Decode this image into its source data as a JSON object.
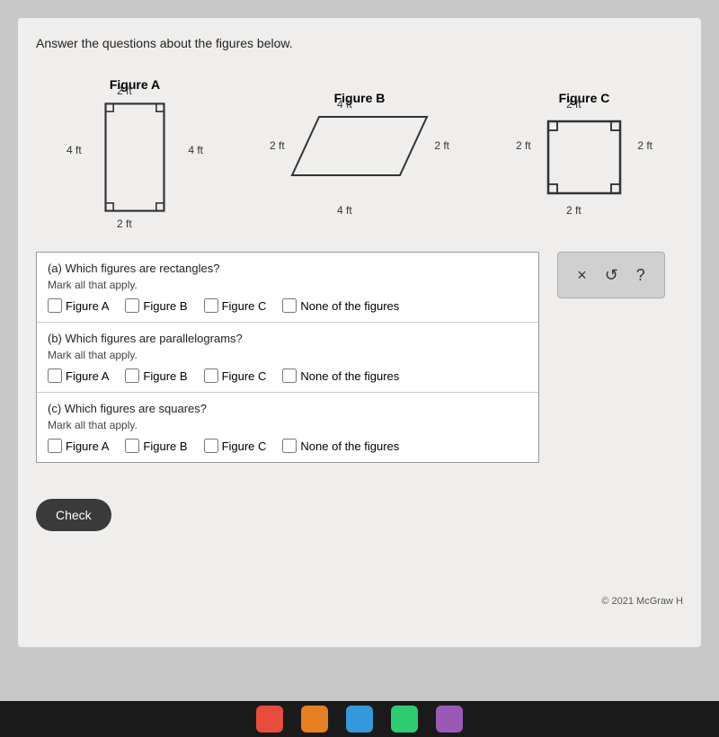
{
  "page": {
    "instruction": "Answer the questions about the figures below.",
    "figures": [
      {
        "id": "figA",
        "title": "Figure A",
        "type": "rectangle",
        "dims": {
          "top": "2 ft",
          "left": "4 ft",
          "right": "4 ft",
          "bottom": "2 ft"
        }
      },
      {
        "id": "figB",
        "title": "Figure B",
        "type": "parallelogram",
        "dims": {
          "top": "4 ft",
          "left": "2 ft",
          "right": "2 ft",
          "bottom": "4 ft"
        }
      },
      {
        "id": "figC",
        "title": "Figure C",
        "type": "square",
        "dims": {
          "top": "2 ft",
          "left": "2 ft",
          "right": "2 ft",
          "bottom": "2 ft"
        }
      }
    ],
    "questions": [
      {
        "id": "q-a",
        "text": "(a) Which figures are rectangles?",
        "sub": "Mark all that apply.",
        "options": [
          "Figure A",
          "Figure B",
          "Figure C",
          "None of the figures"
        ]
      },
      {
        "id": "q-b",
        "text": "(b) Which figures are parallelograms?",
        "sub": "Mark all that apply.",
        "options": [
          "Figure A",
          "Figure B",
          "Figure C",
          "None of the figures"
        ]
      },
      {
        "id": "q-c",
        "text": "(c) Which figures are squares?",
        "sub": "Mark all that apply.",
        "options": [
          "Figure A",
          "Figure B",
          "Figure C",
          "None of the figures"
        ]
      }
    ],
    "side_buttons": {
      "close": "×",
      "refresh": "↺",
      "help": "?"
    },
    "check_button": "Check",
    "copyright": "© 2021 McGraw H"
  }
}
